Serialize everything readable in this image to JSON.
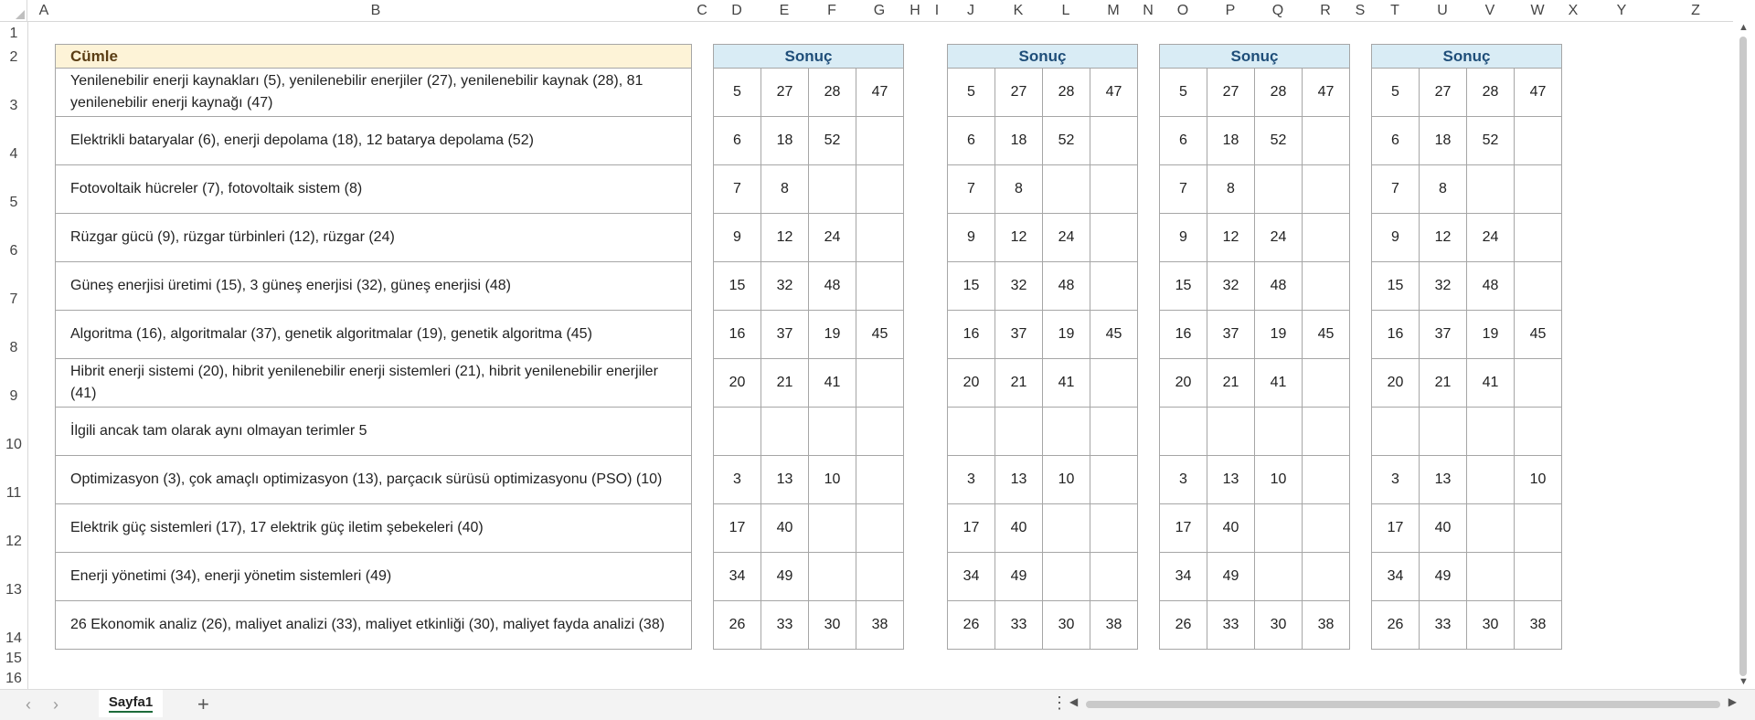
{
  "columns": [
    "A",
    "B",
    "C",
    "D",
    "E",
    "F",
    "G",
    "H",
    "I",
    "J",
    "K",
    "L",
    "M",
    "N",
    "O",
    "P",
    "Q",
    "R",
    "S",
    "T",
    "U",
    "V",
    "W",
    "X",
    "Y",
    "Z"
  ],
  "rows": [
    "1",
    "2",
    "3",
    "4",
    "5",
    "6",
    "7",
    "8",
    "9",
    "10",
    "11",
    "12",
    "13",
    "14",
    "15",
    "16"
  ],
  "header": {
    "cumle": "Cümle",
    "sonuc": "Sonuç"
  },
  "sentences": [
    "Yenilenebilir enerji kaynakları (5), yenilenebilir enerjiler (27), yenilenebilir kaynak (28), 81 yenilenebilir enerji kaynağı (47)",
    "Elektrikli bataryalar (6), enerji depolama (18), 12 batarya depolama (52)",
    "Fotovoltaik hücreler (7), fotovoltaik sistem (8)",
    "Rüzgar gücü (9), rüzgar türbinleri (12), rüzgar (24)",
    "Güneş enerjisi üretimi (15), 3 güneş enerjisi (32), güneş enerjisi (48)",
    "Algoritma (16), algoritmalar (37), genetik algoritmalar (19), genetik algoritma (45)",
    "Hibrit enerji sistemi (20), hibrit yenilenebilir enerji sistemleri (21), hibrit yenilenebilir enerjiler (41)",
    "İlgili ancak tam olarak aynı olmayan terimler 5",
    "Optimizasyon (3), çok amaçlı optimizasyon (13), parçacık sürüsü optimizasyonu (PSO) (10)",
    "Elektrik güç sistemleri (17), 17 elektrik güç iletim şebekeleri (40)",
    "Enerji yönetimi (34), enerji yönetim sistemleri (49)",
    "26 Ekonomik analiz (26), maliyet analizi (33), maliyet etkinliği (30), maliyet fayda analizi (38)"
  ],
  "result_tables": [
    [
      [
        "5",
        "27",
        "28",
        "47"
      ],
      [
        "6",
        "18",
        "52",
        ""
      ],
      [
        "7",
        "8",
        "",
        ""
      ],
      [
        "9",
        "12",
        "24",
        ""
      ],
      [
        "15",
        "32",
        "48",
        ""
      ],
      [
        "16",
        "37",
        "19",
        "45"
      ],
      [
        "20",
        "21",
        "41",
        ""
      ],
      [
        "",
        "",
        "",
        ""
      ],
      [
        "3",
        "13",
        "10",
        ""
      ],
      [
        "17",
        "40",
        "",
        ""
      ],
      [
        "34",
        "49",
        "",
        ""
      ],
      [
        "26",
        "33",
        "30",
        "38"
      ]
    ],
    [
      [
        "5",
        "27",
        "28",
        "47"
      ],
      [
        "6",
        "18",
        "52",
        ""
      ],
      [
        "7",
        "8",
        "",
        ""
      ],
      [
        "9",
        "12",
        "24",
        ""
      ],
      [
        "15",
        "32",
        "48",
        ""
      ],
      [
        "16",
        "37",
        "19",
        "45"
      ],
      [
        "20",
        "21",
        "41",
        ""
      ],
      [
        "",
        "",
        "",
        ""
      ],
      [
        "3",
        "13",
        "10",
        ""
      ],
      [
        "17",
        "40",
        "",
        ""
      ],
      [
        "34",
        "49",
        "",
        ""
      ],
      [
        "26",
        "33",
        "30",
        "38"
      ]
    ],
    [
      [
        "5",
        "27",
        "28",
        "47"
      ],
      [
        "6",
        "18",
        "52",
        ""
      ],
      [
        "7",
        "8",
        "",
        ""
      ],
      [
        "9",
        "12",
        "24",
        ""
      ],
      [
        "15",
        "32",
        "48",
        ""
      ],
      [
        "16",
        "37",
        "19",
        "45"
      ],
      [
        "20",
        "21",
        "41",
        ""
      ],
      [
        "",
        "",
        "",
        ""
      ],
      [
        "3",
        "13",
        "10",
        ""
      ],
      [
        "17",
        "40",
        "",
        ""
      ],
      [
        "34",
        "49",
        "",
        ""
      ],
      [
        "26",
        "33",
        "30",
        "38"
      ]
    ],
    [
      [
        "5",
        "27",
        "28",
        "47"
      ],
      [
        "6",
        "18",
        "52",
        ""
      ],
      [
        "7",
        "8",
        "",
        ""
      ],
      [
        "9",
        "12",
        "24",
        ""
      ],
      [
        "15",
        "32",
        "48",
        ""
      ],
      [
        "16",
        "37",
        "19",
        "45"
      ],
      [
        "20",
        "21",
        "41",
        ""
      ],
      [
        "",
        "",
        "",
        ""
      ],
      [
        "3",
        "13",
        "",
        ""
      ],
      [
        "17",
        "40",
        "",
        ""
      ],
      [
        "34",
        "49",
        "",
        ""
      ],
      [
        "26",
        "33",
        "30",
        "38"
      ]
    ]
  ],
  "w_column_extra": {
    "row": "8",
    "value": "10"
  },
  "sheet_tab": "Sayfa1",
  "tab_bar": {
    "prev": "‹",
    "next": "›",
    "add": "+",
    "more": "⋮"
  },
  "scroll_glyphs": {
    "left": "◀",
    "right": "▶",
    "up": "▲",
    "down": "▼"
  }
}
